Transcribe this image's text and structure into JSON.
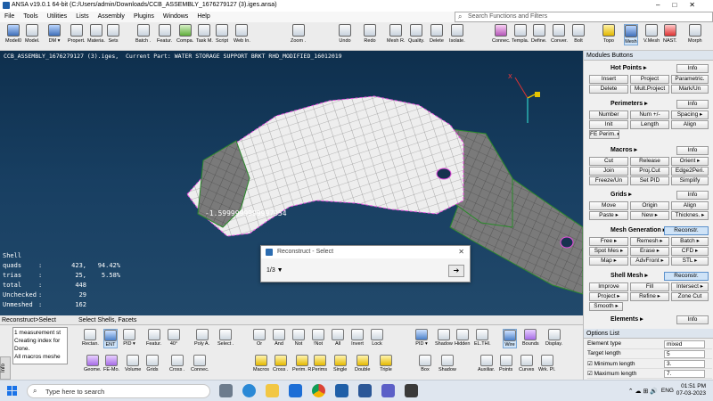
{
  "window": {
    "title": "ANSA v19.0.1 64-bit (C:/Users/admin/Downloads/CCB_ASSEMBLY_1676279127 (3).iges.ansa)",
    "controls": [
      "–",
      "□",
      "✕"
    ]
  },
  "menu": [
    "File",
    "Tools",
    "Utilities",
    "Lists",
    "Assembly",
    "Plugins",
    "Windows",
    "Help"
  ],
  "search": {
    "placeholder": "Search Functions and Filters"
  },
  "toolbar": [
    {
      "label": "Model0",
      "icon": "model-icon",
      "color": "bl"
    },
    {
      "label": "Model.",
      "icon": "model-browser-icon",
      "color": ""
    },
    {
      "label": "DM ▾",
      "icon": "data-management-icon",
      "color": "bl"
    },
    {
      "label": "Propert.",
      "icon": "properties-icon",
      "color": ""
    },
    {
      "label": "Materia.",
      "icon": "materials-icon",
      "color": ""
    },
    {
      "label": "Sets",
      "icon": "sets-icon",
      "color": ""
    },
    {
      "label": "Batch .",
      "icon": "batch-icon",
      "color": ""
    },
    {
      "label": "Featur.",
      "icon": "features-icon",
      "color": ""
    },
    {
      "label": "Compa.",
      "icon": "compare-icon",
      "color": "gr"
    },
    {
      "label": "Task M.",
      "icon": "task-manager-icon",
      "color": ""
    },
    {
      "label": "Script",
      "icon": "script-icon",
      "color": ""
    },
    {
      "label": "Web In.",
      "icon": "web-icon",
      "color": ""
    },
    {
      "label": "Zoom .",
      "icon": "zoom-icon",
      "color": ""
    },
    {
      "label": "Undo",
      "icon": "undo-icon",
      "color": ""
    },
    {
      "label": "Redo",
      "icon": "redo-icon",
      "color": ""
    },
    {
      "label": "Mesh R.",
      "icon": "mesh-refine-icon",
      "color": ""
    },
    {
      "label": "Quality.",
      "icon": "quality-icon",
      "color": ""
    },
    {
      "label": "Delete",
      "icon": "delete-icon",
      "color": ""
    },
    {
      "label": "Isolate.",
      "icon": "isolate-icon",
      "color": ""
    },
    {
      "label": "Connec.",
      "icon": "connections-icon",
      "color": "pi"
    },
    {
      "label": "Templa.",
      "icon": "templates-icon",
      "color": ""
    },
    {
      "label": "Define.",
      "icon": "define-icon",
      "color": ""
    },
    {
      "label": "Conver.",
      "icon": "convert-icon",
      "color": ""
    },
    {
      "label": "Bolt",
      "icon": "bolt-icon",
      "color": ""
    },
    {
      "label": "Topo",
      "icon": "topo-icon",
      "color": "ye"
    },
    {
      "label": "Mesh",
      "icon": "mesh-icon",
      "color": "bl"
    },
    {
      "label": "V.Mesh",
      "icon": "volume-mesh-icon",
      "color": ""
    },
    {
      "label": "NAST.",
      "icon": "nastran-icon",
      "color": "rd"
    },
    {
      "label": "Morph",
      "icon": "morph-icon",
      "color": ""
    }
  ],
  "viewport": {
    "info": "CCB_ASSEMBLY_1676279127 (3).iges,  Current Part: WATER STORAGE SUPPORT BRKT RHD_MODIFIED_16012019",
    "measurement": "-1.5999999999997954",
    "axis_label": "X",
    "stats": {
      "title": "Shell",
      "rows": [
        {
          "k": "quads",
          "v": "423,",
          "p": "94.42%"
        },
        {
          "k": "trias",
          "v": "25,",
          "p": "5.58%"
        },
        {
          "k": "total",
          "v": "448",
          "p": ""
        },
        {
          "k": "Unchecked",
          "v": "29",
          "p": ""
        },
        {
          "k": "Unmeshed",
          "v": "162",
          "p": ""
        }
      ]
    }
  },
  "dialog": {
    "title": "Reconstruct - Select",
    "page": "1/3 ▼",
    "close": "✕",
    "go": "➔"
  },
  "panel": {
    "header": "Modules Buttons",
    "hot_points": {
      "title": "Hot Points ▸",
      "buttons": [
        "Info",
        "Insert",
        "Project",
        "Parametric.",
        "Delete",
        "Mult.Project",
        "Mark/Un"
      ]
    },
    "perimeters": {
      "title": "Perimeters ▸",
      "buttons": [
        "Info",
        "Number",
        "Num +/-",
        "Spacing ▸",
        "Init",
        "Length",
        "Align",
        "FE Perim. ▸"
      ]
    },
    "macros": {
      "title": "Macros ▸",
      "buttons": [
        "Info",
        "Cut",
        "Release",
        "Orient ▸",
        "Join",
        "Proj.Cut",
        "Edge2Peri.",
        "Freeze/Un",
        "Set PID",
        "Simplify"
      ]
    },
    "grids": {
      "title": "Grids ▸",
      "buttons": [
        "Info",
        "Move",
        "Origin",
        "Align",
        "Paste ▸",
        "New ▸",
        "Thicknes. ▸"
      ]
    },
    "mesh_generation": {
      "title": "Mesh Generation ▸",
      "buttons": [
        "Reconstr.",
        "Free ▸",
        "Remesh ▸",
        "Batch ▸",
        "Spot Mes ▸",
        "Erase ▸",
        "CFD ▸",
        "Map ▸",
        "AdvFront ▸",
        "STL ▸"
      ]
    },
    "shell_mesh": {
      "title": "Shell Mesh ▸",
      "buttons": [
        "Reconstr.",
        "Improve",
        "Fill",
        "Intersect ▸",
        "Project ▸",
        "Refine ▸",
        "Zone Cut",
        "Smooth ▸"
      ]
    },
    "elements": {
      "title": "Elements ▸",
      "buttons": [
        "Info"
      ]
    }
  },
  "status_row": {
    "path": "Reconstruct>Select",
    "prompt": "Select Shells, Facets"
  },
  "messages": [
    "1 measurement st",
    "Creating index for",
    "Done.",
    "All macros meshe"
  ],
  "info_tab": "Info",
  "bottom_row1": [
    {
      "label": "Rectan.",
      "icon": "rectangle-select-icon",
      "color": ""
    },
    {
      "label": "ENT",
      "icon": "entity-icon",
      "color": "bl"
    },
    {
      "label": "PID ▾",
      "icon": "pid-icon",
      "color": ""
    },
    {
      "label": "Featur.",
      "icon": "feature-select-icon",
      "color": ""
    },
    {
      "label": "40°",
      "icon": "angle-field-icon",
      "color": ""
    },
    {
      "label": "Poly A.",
      "icon": "polygon-icon",
      "color": ""
    },
    {
      "label": "Select .",
      "icon": "select-icon",
      "color": ""
    },
    {
      "label": "Or",
      "icon": "or-icon",
      "color": ""
    },
    {
      "label": "And",
      "icon": "and-icon",
      "color": ""
    },
    {
      "label": "Not",
      "icon": "not-icon",
      "color": ""
    },
    {
      "label": "!Not",
      "icon": "exclude-icon",
      "color": ""
    },
    {
      "label": "All",
      "icon": "all-icon",
      "color": ""
    },
    {
      "label": "Invert",
      "icon": "invert-icon",
      "color": ""
    },
    {
      "label": "Lock",
      "icon": "lock-icon",
      "color": ""
    },
    {
      "label": "PID ▾",
      "icon": "pid-display-icon",
      "color": "bl"
    },
    {
      "label": "Shadow",
      "icon": "shadow-icon",
      "color": ""
    },
    {
      "label": "Hidden",
      "icon": "hidden-icon",
      "color": ""
    },
    {
      "label": "EL.THI.",
      "icon": "element-thickness-icon",
      "color": ""
    },
    {
      "label": "Wire",
      "icon": "wire-icon",
      "color": "bl"
    },
    {
      "label": "Bounds",
      "icon": "bounds-icon",
      "color": "pu"
    },
    {
      "label": "Display.",
      "icon": "display-icon",
      "color": ""
    }
  ],
  "bottom_row2": [
    {
      "label": "Geome.",
      "icon": "geometry-icon",
      "color": "pu"
    },
    {
      "label": "FE-Mo.",
      "icon": "fe-model-icon",
      "color": "pu"
    },
    {
      "label": "Volume",
      "icon": "volume-icon",
      "color": ""
    },
    {
      "label": "Grids",
      "icon": "grids-icon",
      "color": ""
    },
    {
      "label": "Cross .",
      "icon": "cross-section-icon",
      "color": ""
    },
    {
      "label": "Connec.",
      "icon": "connections-bottom-icon",
      "color": ""
    },
    {
      "label": "Macros",
      "icon": "macros-icon",
      "color": "ye"
    },
    {
      "label": "Cross .",
      "icon": "cross-icon",
      "color": "ye"
    },
    {
      "label": "Perim. R.",
      "icon": "perimeter-icon",
      "color": "ye"
    },
    {
      "label": "Perims",
      "icon": "perims-icon",
      "color": "ye"
    },
    {
      "label": "Single",
      "icon": "single-icon",
      "color": "ye"
    },
    {
      "label": "Double",
      "icon": "double-icon",
      "color": "ye"
    },
    {
      "label": "Triple",
      "icon": "triple-icon",
      "color": "ye"
    },
    {
      "label": "Box",
      "icon": "box-icon",
      "color": ""
    },
    {
      "label": "Shadow",
      "icon": "shadow2-icon",
      "color": ""
    },
    {
      "label": "Auxiliar.",
      "icon": "auxiliary-icon",
      "color": ""
    },
    {
      "label": "Points",
      "icon": "points-icon",
      "color": ""
    },
    {
      "label": "Curves",
      "icon": "curves-icon",
      "color": ""
    },
    {
      "label": "Wrk. Pl.",
      "icon": "work-plane-icon",
      "color": ""
    }
  ],
  "options": {
    "header": "Options List",
    "rows": [
      {
        "label": "Element type",
        "value": "mixed"
      },
      {
        "label": "Target length",
        "value": "5"
      },
      {
        "label": "☑ Minimum length",
        "value": "3."
      },
      {
        "label": "☑ Maximum length",
        "value": "7."
      }
    ]
  },
  "taskbar": {
    "search": "Type here to search",
    "lang": "ENG",
    "time": "01:51 PM",
    "date": "07-03-2023",
    "tray": "⌃ ☁ ⊞ 🔊"
  }
}
